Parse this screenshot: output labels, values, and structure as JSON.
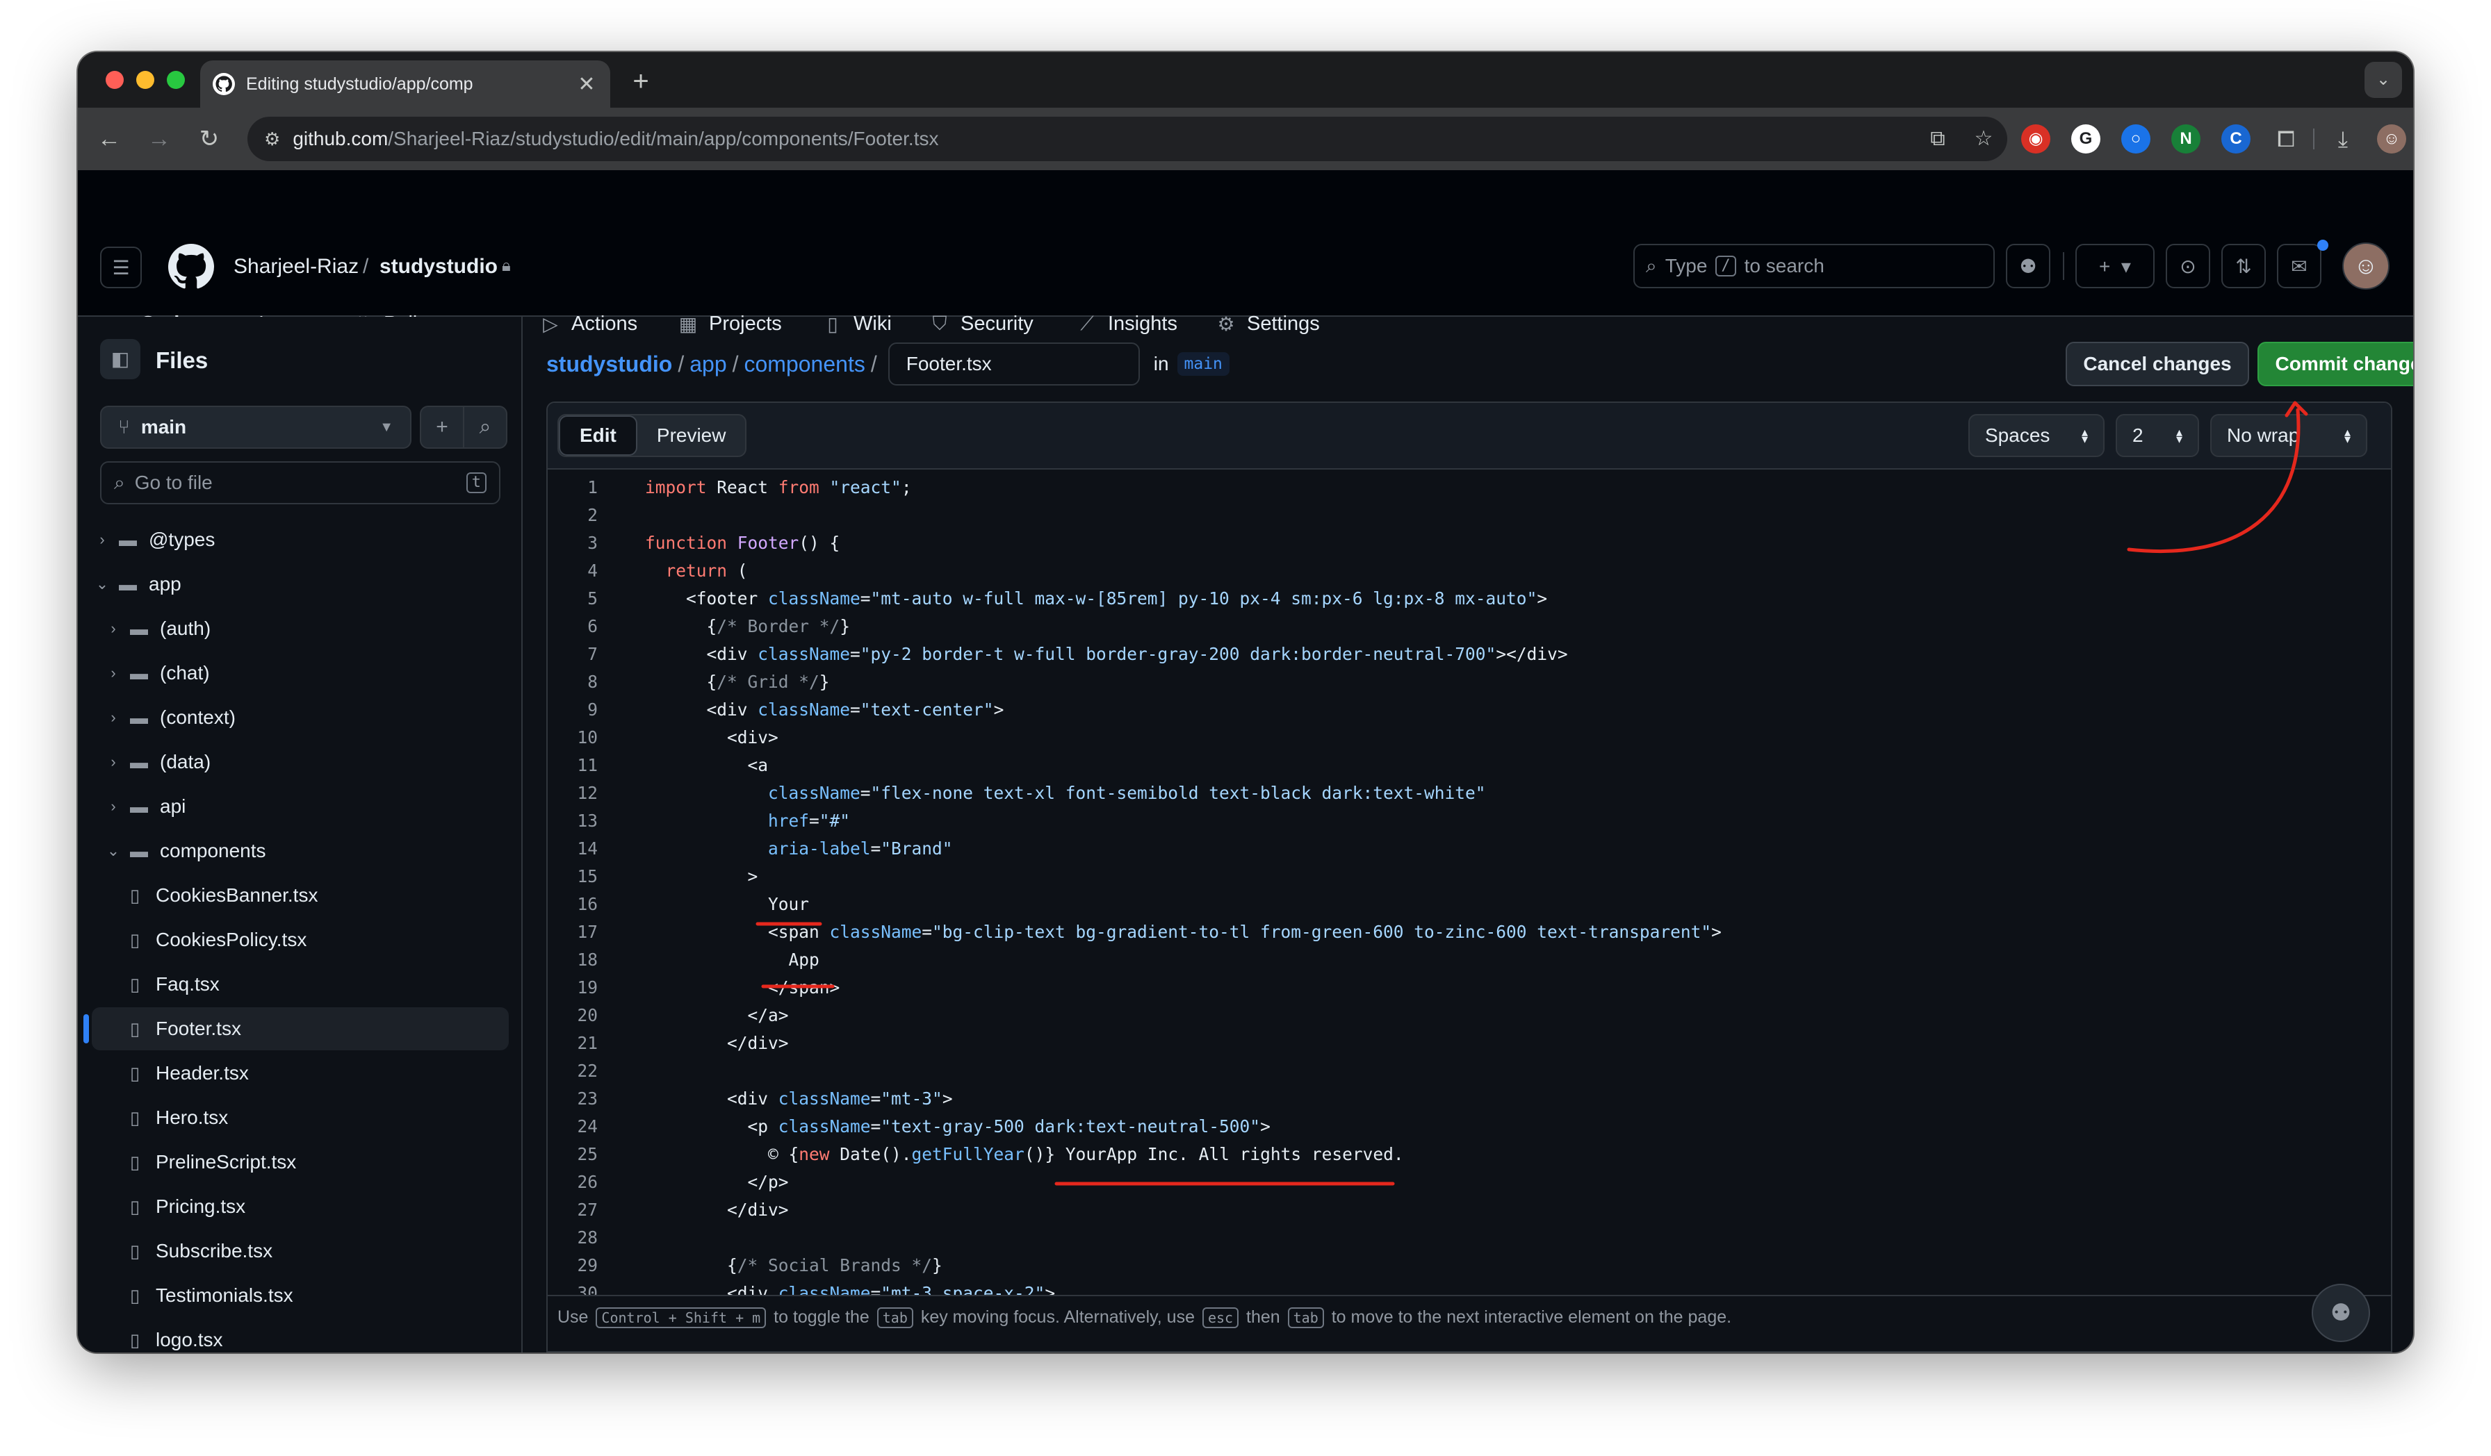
{
  "browser": {
    "tab_title": "Editing studystudio/app/comp",
    "url_host": "github.com",
    "url_path": "/Sharjeel-Riaz/studystudio/edit/main/app/components/Footer.tsx"
  },
  "header": {
    "owner": "Sharjeel-Riaz",
    "separator": "/",
    "repo": "studystudio",
    "search_prefix": "Type",
    "search_key": "/",
    "search_suffix": "to search"
  },
  "nav": {
    "items": [
      {
        "label": "Code",
        "icon": "code-icon"
      },
      {
        "label": "Issues",
        "icon": "issue-icon"
      },
      {
        "label": "Pull requests",
        "icon": "pull-request-icon"
      },
      {
        "label": "Actions",
        "icon": "play-icon"
      },
      {
        "label": "Projects",
        "icon": "table-icon"
      },
      {
        "label": "Wiki",
        "icon": "book-icon"
      },
      {
        "label": "Security",
        "icon": "shield-icon"
      },
      {
        "label": "Insights",
        "icon": "graph-icon"
      },
      {
        "label": "Settings",
        "icon": "gear-icon"
      }
    ]
  },
  "sidebar": {
    "title": "Files",
    "branch": "main",
    "goto_placeholder": "Go to file",
    "goto_key": "t",
    "tree": [
      {
        "label": "@types"
      },
      {
        "label": "app"
      },
      {
        "label": "(auth)"
      },
      {
        "label": "(chat)"
      },
      {
        "label": "(context)"
      },
      {
        "label": "(data)"
      },
      {
        "label": "api"
      },
      {
        "label": "components"
      },
      {
        "label": "CookiesBanner.tsx"
      },
      {
        "label": "CookiesPolicy.tsx"
      },
      {
        "label": "Faq.tsx"
      },
      {
        "label": "Footer.tsx"
      },
      {
        "label": "Header.tsx"
      },
      {
        "label": "Hero.tsx"
      },
      {
        "label": "PrelineScript.tsx"
      },
      {
        "label": "Pricing.tsx"
      },
      {
        "label": "Subscribe.tsx"
      },
      {
        "label": "Testimonials.tsx"
      },
      {
        "label": "logo.tsx"
      }
    ]
  },
  "editor": {
    "crumb": [
      "studystudio",
      "app",
      "components"
    ],
    "filename": "Footer.tsx",
    "in_label": "in",
    "branch": "main",
    "cancel_label": "Cancel changes",
    "commit_label": "Commit changes...",
    "tab_edit": "Edit",
    "tab_preview": "Preview",
    "indent_mode": "Spaces",
    "indent_size": "2",
    "wrap_mode": "No wrap",
    "lines": [
      [
        [
          "import ",
          "kw"
        ],
        [
          "React ",
          "pl"
        ],
        [
          "from ",
          "kw"
        ],
        [
          "\"react\"",
          "st"
        ],
        [
          ";",
          "pl"
        ]
      ],
      [],
      [
        [
          "function ",
          "kw"
        ],
        [
          "Footer",
          "fn"
        ],
        [
          "() {",
          "pl"
        ]
      ],
      [
        [
          "  ",
          "pl"
        ],
        [
          "return ",
          "kw"
        ],
        [
          "(",
          "pl"
        ]
      ],
      [
        [
          "    <footer ",
          "pl"
        ],
        [
          "className",
          "at"
        ],
        [
          "=",
          "pl"
        ],
        [
          "\"mt-auto w-full max-w-[85rem] py-10 px-4 sm:px-6 lg:px-8 mx-auto\"",
          "st"
        ],
        [
          ">",
          "pl"
        ]
      ],
      [
        [
          "      {",
          "pl"
        ],
        [
          "/* Border */",
          "cm"
        ],
        [
          "}",
          "pl"
        ]
      ],
      [
        [
          "      <div ",
          "pl"
        ],
        [
          "className",
          "at"
        ],
        [
          "=",
          "pl"
        ],
        [
          "\"py-2 border-t w-full border-gray-200 dark:border-neutral-700\"",
          "st"
        ],
        [
          "></div>",
          "pl"
        ]
      ],
      [
        [
          "      {",
          "pl"
        ],
        [
          "/* Grid */",
          "cm"
        ],
        [
          "}",
          "pl"
        ]
      ],
      [
        [
          "      <div ",
          "pl"
        ],
        [
          "className",
          "at"
        ],
        [
          "=",
          "pl"
        ],
        [
          "\"text-center\"",
          "st"
        ],
        [
          ">",
          "pl"
        ]
      ],
      [
        [
          "        <div>",
          "pl"
        ]
      ],
      [
        [
          "          <a",
          "pl"
        ]
      ],
      [
        [
          "            ",
          "pl"
        ],
        [
          "className",
          "at"
        ],
        [
          "=",
          "pl"
        ],
        [
          "\"flex-none text-xl font-semibold text-black dark:text-white\"",
          "st"
        ]
      ],
      [
        [
          "            ",
          "pl"
        ],
        [
          "href",
          "at"
        ],
        [
          "=",
          "pl"
        ],
        [
          "\"#\"",
          "st"
        ]
      ],
      [
        [
          "            ",
          "pl"
        ],
        [
          "aria-label",
          "at"
        ],
        [
          "=",
          "pl"
        ],
        [
          "\"Brand\"",
          "st"
        ]
      ],
      [
        [
          "          >",
          "pl"
        ]
      ],
      [
        [
          "            Your",
          "pl"
        ]
      ],
      [
        [
          "            <span ",
          "pl"
        ],
        [
          "className",
          "at"
        ],
        [
          "=",
          "pl"
        ],
        [
          "\"bg-clip-text bg-gradient-to-tl from-green-600 to-zinc-600 text-transparent\"",
          "st"
        ],
        [
          ">",
          "pl"
        ]
      ],
      [
        [
          "              App",
          "pl"
        ]
      ],
      [
        [
          "            </span>",
          "pl"
        ]
      ],
      [
        [
          "          </a>",
          "pl"
        ]
      ],
      [
        [
          "        </div>",
          "pl"
        ]
      ],
      [],
      [
        [
          "        <div ",
          "pl"
        ],
        [
          "className",
          "at"
        ],
        [
          "=",
          "pl"
        ],
        [
          "\"mt-3\"",
          "st"
        ],
        [
          ">",
          "pl"
        ]
      ],
      [
        [
          "          <p ",
          "pl"
        ],
        [
          "className",
          "at"
        ],
        [
          "=",
          "pl"
        ],
        [
          "\"text-gray-500 dark:text-neutral-500\"",
          "st"
        ],
        [
          ">",
          "pl"
        ]
      ],
      [
        [
          "            © {",
          "pl"
        ],
        [
          "new ",
          "kw"
        ],
        [
          "Date().",
          "pl"
        ],
        [
          "getFullYear",
          "at"
        ],
        [
          "()} YourApp Inc. All rights reserved.",
          "pl"
        ]
      ],
      [
        [
          "          </p>",
          "pl"
        ]
      ],
      [
        [
          "        </div>",
          "pl"
        ]
      ],
      [],
      [
        [
          "        {",
          "pl"
        ],
        [
          "/* Social Brands */",
          "cm"
        ],
        [
          "}",
          "pl"
        ]
      ],
      [
        [
          "        <div ",
          "pl"
        ],
        [
          "className",
          "at"
        ],
        [
          "=",
          "pl"
        ],
        [
          "\"mt-3 space-x-2\"",
          "st"
        ],
        [
          ">",
          "pl"
        ]
      ]
    ],
    "status": {
      "use": "Use",
      "combo": "Control + Shift + m",
      "t1": "to toggle the",
      "tab_key": "tab",
      "t2": "key moving focus. Alternatively, use",
      "esc_key": "esc",
      "t3": "then",
      "t4": "to move to the next interactive element on the page."
    }
  },
  "colors": {
    "accent_link": "#4493f8",
    "commit_green": "#238636",
    "annotation_red": "#e5281d"
  }
}
